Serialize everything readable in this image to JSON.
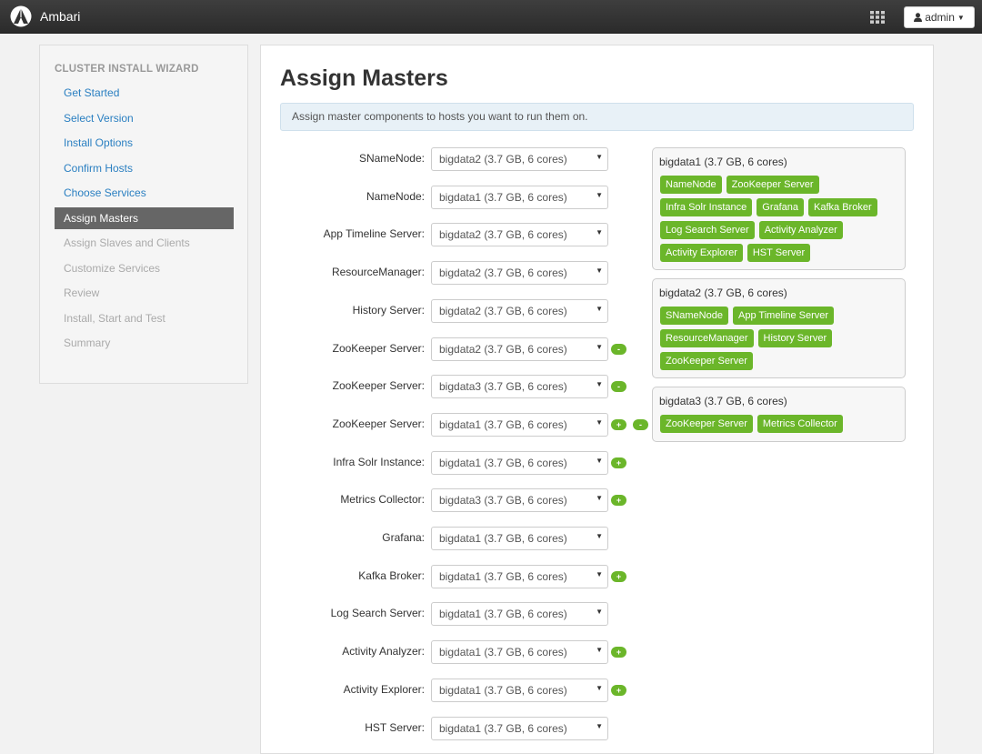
{
  "app": {
    "name": "Ambari",
    "user_label": "admin"
  },
  "icons": {
    "logo": "ambari-logo-icon",
    "apps": "grid-icon",
    "user": "user-icon",
    "caret": "caret-down-icon",
    "select_arrow": "chevron-down-icon"
  },
  "colors": {
    "accent": "#6bb62a",
    "link": "#2a7fc1",
    "active_step": "#666666",
    "topbar": "#333333"
  },
  "sidebar": {
    "title": "CLUSTER INSTALL WIZARD",
    "steps": [
      {
        "label": "Get Started",
        "state": "done"
      },
      {
        "label": "Select Version",
        "state": "done"
      },
      {
        "label": "Install Options",
        "state": "done"
      },
      {
        "label": "Confirm Hosts",
        "state": "done"
      },
      {
        "label": "Choose Services",
        "state": "done"
      },
      {
        "label": "Assign Masters",
        "state": "active"
      },
      {
        "label": "Assign Slaves and Clients",
        "state": "disabled"
      },
      {
        "label": "Customize Services",
        "state": "disabled"
      },
      {
        "label": "Review",
        "state": "disabled"
      },
      {
        "label": "Install, Start and Test",
        "state": "disabled"
      },
      {
        "label": "Summary",
        "state": "disabled"
      }
    ]
  },
  "main": {
    "title": "Assign Masters",
    "info": "Assign master components to hosts you want to run them on.",
    "assignments": [
      {
        "label": "SNameNode:",
        "host": "bigdata2 (3.7 GB, 6 cores)",
        "plus": false,
        "minus": false
      },
      {
        "label": "NameNode:",
        "host": "bigdata1 (3.7 GB, 6 cores)",
        "plus": false,
        "minus": false
      },
      {
        "label": "App Timeline Server:",
        "host": "bigdata2 (3.7 GB, 6 cores)",
        "plus": false,
        "minus": false
      },
      {
        "label": "ResourceManager:",
        "host": "bigdata2 (3.7 GB, 6 cores)",
        "plus": false,
        "minus": false
      },
      {
        "label": "History Server:",
        "host": "bigdata2 (3.7 GB, 6 cores)",
        "plus": false,
        "minus": false
      },
      {
        "label": "ZooKeeper Server:",
        "host": "bigdata2 (3.7 GB, 6 cores)",
        "plus": false,
        "minus": true
      },
      {
        "label": "ZooKeeper Server:",
        "host": "bigdata3 (3.7 GB, 6 cores)",
        "plus": false,
        "minus": true
      },
      {
        "label": "ZooKeeper Server:",
        "host": "bigdata1 (3.7 GB, 6 cores)",
        "plus": true,
        "minus": true
      },
      {
        "label": "Infra Solr Instance:",
        "host": "bigdata1 (3.7 GB, 6 cores)",
        "plus": true,
        "minus": false
      },
      {
        "label": "Metrics Collector:",
        "host": "bigdata3 (3.7 GB, 6 cores)",
        "plus": true,
        "minus": false
      },
      {
        "label": "Grafana:",
        "host": "bigdata1 (3.7 GB, 6 cores)",
        "plus": false,
        "minus": false
      },
      {
        "label": "Kafka Broker:",
        "host": "bigdata1 (3.7 GB, 6 cores)",
        "plus": true,
        "minus": false
      },
      {
        "label": "Log Search Server:",
        "host": "bigdata1 (3.7 GB, 6 cores)",
        "plus": false,
        "minus": false
      },
      {
        "label": "Activity Analyzer:",
        "host": "bigdata1 (3.7 GB, 6 cores)",
        "plus": true,
        "minus": false
      },
      {
        "label": "Activity Explorer:",
        "host": "bigdata1 (3.7 GB, 6 cores)",
        "plus": true,
        "minus": false
      },
      {
        "label": "HST Server:",
        "host": "bigdata1 (3.7 GB, 6 cores)",
        "plus": false,
        "minus": false
      }
    ],
    "plus_symbol": "+",
    "minus_symbol": "-",
    "hosts": [
      {
        "title": "bigdata1 (3.7 GB, 6 cores)",
        "components": [
          "NameNode",
          "ZooKeeper Server",
          "Infra Solr Instance",
          "Grafana",
          "Kafka Broker",
          "Log Search Server",
          "Activity Analyzer",
          "Activity Explorer",
          "HST Server"
        ]
      },
      {
        "title": "bigdata2 (3.7 GB, 6 cores)",
        "components": [
          "SNameNode",
          "App Timeline Server",
          "ResourceManager",
          "History Server",
          "ZooKeeper Server"
        ]
      },
      {
        "title": "bigdata3 (3.7 GB, 6 cores)",
        "components": [
          "ZooKeeper Server",
          "Metrics Collector"
        ]
      }
    ]
  }
}
